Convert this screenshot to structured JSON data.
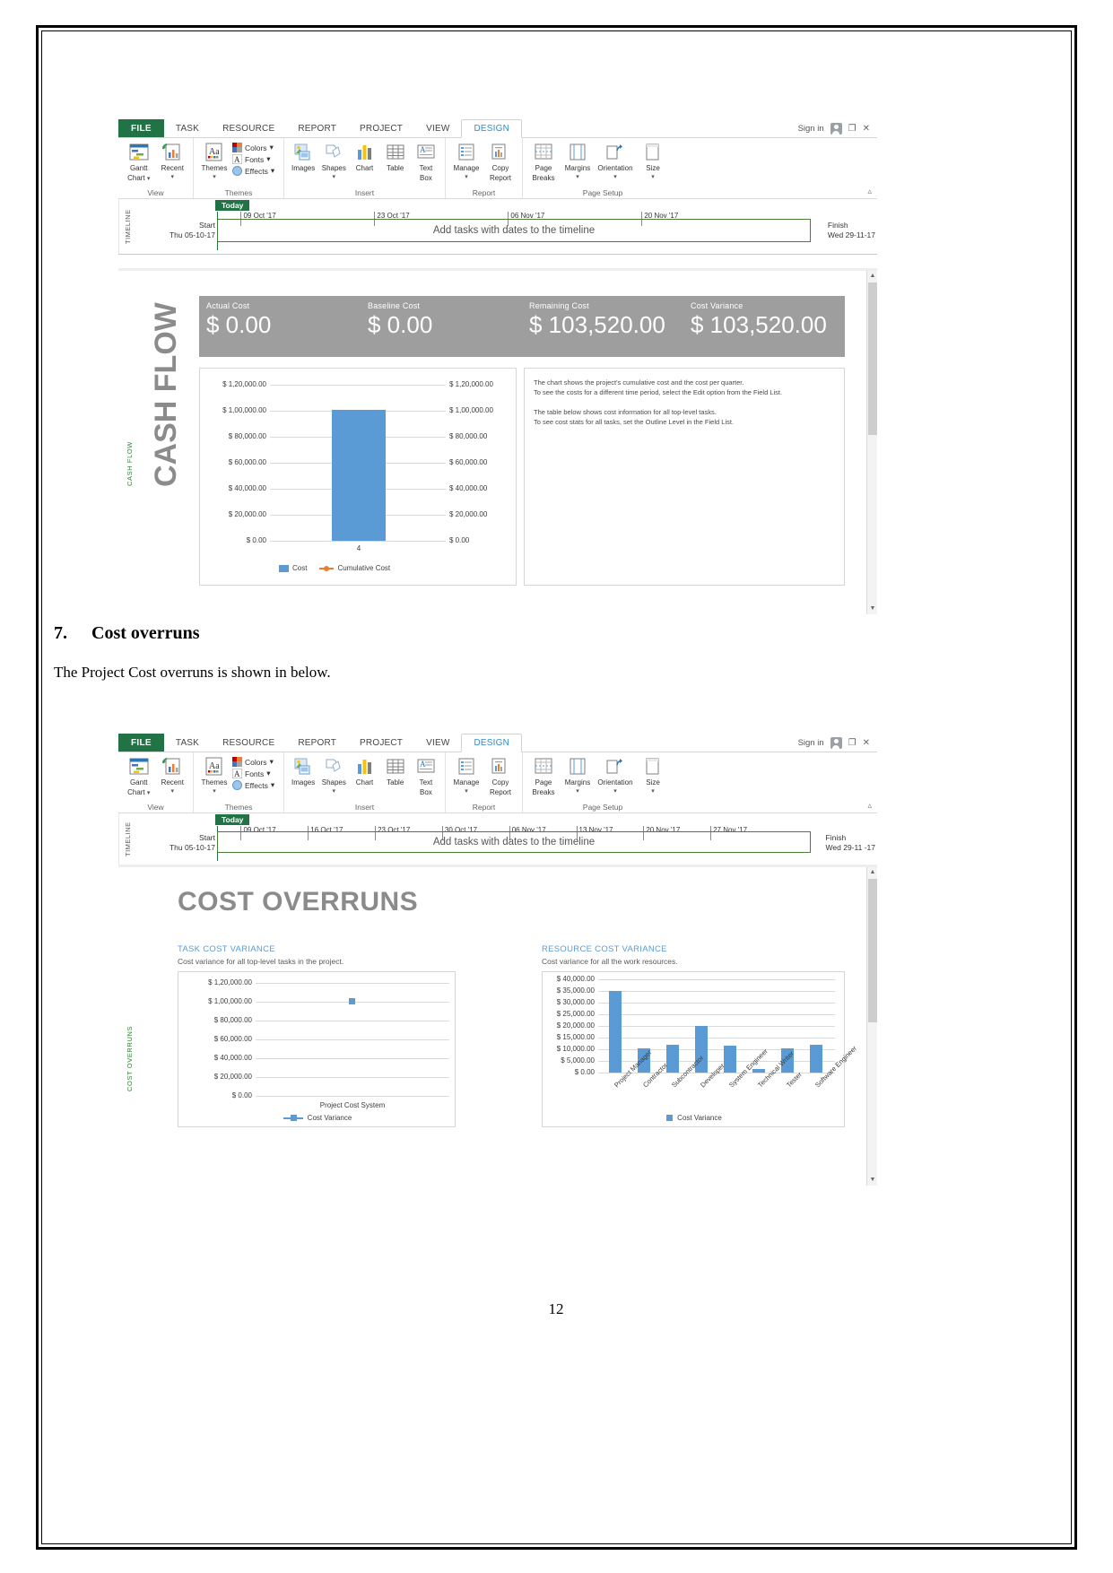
{
  "document": {
    "page_number": "12",
    "heading_number": "7.",
    "heading_text": "Cost overruns",
    "paragraph": "The Project Cost overruns is shown in below."
  },
  "ribbon": {
    "file_tab": "FILE",
    "tabs": [
      "TASK",
      "RESOURCE",
      "REPORT",
      "PROJECT",
      "VIEW"
    ],
    "active_tab": "DESIGN",
    "sign_in": "Sign in",
    "restore_icon": "restore-window-icon",
    "close_icon": "close-icon",
    "collapse_icon": "collapse-ribbon-icon",
    "groups": [
      {
        "label": "View",
        "buttons": [
          {
            "label_1": "Gantt",
            "label_2": "Chart",
            "caret": true,
            "icon": "gantt-chart-icon"
          },
          {
            "label_1": "Recent",
            "label_2": "",
            "caret": true,
            "icon": "recent-reports-icon"
          }
        ]
      },
      {
        "label": "Themes",
        "buttons": [
          {
            "label_1": "Themes",
            "label_2": "",
            "caret": true,
            "icon": "themes-icon"
          }
        ],
        "small_buttons": [
          {
            "label": "Colors",
            "icon": "colors-icon"
          },
          {
            "label": "Fonts",
            "icon": "fonts-icon"
          },
          {
            "label": "Effects",
            "icon": "effects-icon"
          }
        ]
      },
      {
        "label": "Insert",
        "buttons": [
          {
            "label_1": "Images",
            "label_2": "",
            "caret": false,
            "icon": "images-icon"
          },
          {
            "label_1": "Shapes",
            "label_2": "",
            "caret": true,
            "icon": "shapes-icon"
          },
          {
            "label_1": "Chart",
            "label_2": "",
            "caret": false,
            "icon": "chart-icon"
          },
          {
            "label_1": "Table",
            "label_2": "",
            "caret": false,
            "icon": "table-icon"
          },
          {
            "label_1": "Text",
            "label_2": "Box",
            "caret": false,
            "icon": "text-box-icon"
          }
        ]
      },
      {
        "label": "Report",
        "buttons": [
          {
            "label_1": "Manage",
            "label_2": "",
            "caret": true,
            "icon": "manage-icon"
          },
          {
            "label_1": "Copy",
            "label_2": "Report",
            "caret": false,
            "icon": "copy-report-icon"
          }
        ]
      },
      {
        "label": "Page Setup",
        "buttons": [
          {
            "label_1": "Page",
            "label_2": "Breaks",
            "caret": false,
            "icon": "page-breaks-icon"
          },
          {
            "label_1": "Margins",
            "label_2": "",
            "caret": true,
            "icon": "margins-icon"
          },
          {
            "label_1": "Orientation",
            "label_2": "",
            "caret": true,
            "icon": "orientation-icon"
          },
          {
            "label_1": "Size",
            "label_2": "",
            "caret": true,
            "icon": "size-icon"
          }
        ]
      }
    ]
  },
  "timeline_1": {
    "side_label": "TIMELINE",
    "today_badge": "Today",
    "start_label": "Start",
    "start_date": "Thu 05-10-17",
    "finish_label": "Finish",
    "finish_date": "Wed 29-11-17",
    "bar_text": "Add tasks with dates to the timeline",
    "ticks": [
      "09 Oct '17",
      "23 Oct '17",
      "06 Nov '17",
      "20 Nov '17"
    ]
  },
  "timeline_2": {
    "side_label": "TIMELINE",
    "today_badge": "Today",
    "start_label": "Start",
    "start_date": "Thu 05-10-17",
    "finish_label": "Finish",
    "finish_date": "Wed 29-11 -17",
    "bar_text": "Add tasks with dates to the timeline",
    "ticks": [
      "09 Oct '17",
      "16 Oct '17",
      "23 Oct '17",
      "30 Oct '17",
      "06 Nov '17",
      "13 Nov '17",
      "20 Nov '17",
      "27 Nov '17"
    ]
  },
  "cash_flow_report": {
    "side_label": "CASH FLOW",
    "title": "CASH FLOW",
    "kpis": [
      {
        "label": "Actual Cost",
        "value": "$ 0.00"
      },
      {
        "label": "Baseline Cost",
        "value": "$ 0.00"
      },
      {
        "label": "Remaining Cost",
        "value": "$ 103,520.00"
      },
      {
        "label": "Cost Variance",
        "value": "$ 103,520.00"
      }
    ],
    "description": "The chart shows the project's cumulative cost and the cost per quarter.\nTo see the costs for a different time period, select the Edit option from the Field List.\n\nThe table below shows cost information for all top-level tasks.\nTo see cost stats for all tasks, set the Outline Level in the Field List."
  },
  "cost_overruns_report": {
    "side_label": "COST OVERRUNS",
    "title": "COST OVERRUNS",
    "task_section": {
      "heading": "TASK COST VARIANCE",
      "description": "Cost variance for all top-level tasks in the project."
    },
    "resource_section": {
      "heading": "RESOURCE COST VARIANCE",
      "description": "Cost variance for all the work resources."
    }
  },
  "chart_data": [
    {
      "type": "bar",
      "title": "Cash Flow",
      "categories": [
        "4"
      ],
      "values": [
        103520
      ],
      "series": [
        {
          "name": "Cost",
          "values": [
            103520
          ],
          "color": "#5b9bd5"
        },
        {
          "name": "Cumulative Cost",
          "values": [
            103520
          ],
          "color": "#ed7d31"
        }
      ],
      "legend": [
        "Cost",
        "Cumulative Cost"
      ],
      "legend_position": "bottom",
      "ylabel": "",
      "xlabel": "",
      "ylim": [
        0,
        120000
      ],
      "yticks": [
        "$ 0.00",
        "$ 20,000.00",
        "$ 40,000.00",
        "$ 60,000.00",
        "$ 80,000.00",
        "$ 1,00,000.00",
        "$ 1,20,000.00"
      ],
      "ytick_values": [
        0,
        20000,
        40000,
        60000,
        80000,
        100000,
        120000
      ],
      "secondary_yticks": [
        "$ 0.00",
        "$ 20,000.00",
        "$ 40,000.00",
        "$ 60,000.00",
        "$ 80,000.00",
        "$ 1,00,000.00",
        "$ 1,20,000.00"
      ],
      "grid": true
    },
    {
      "type": "line",
      "title": "TASK COST VARIANCE",
      "categories": [
        "Project Cost System"
      ],
      "values": [
        103520
      ],
      "series": [
        {
          "name": "Cost Variance",
          "values": [
            103520
          ],
          "color": "#5b9bd5"
        }
      ],
      "legend": [
        "Cost Variance"
      ],
      "legend_position": "bottom",
      "ylim": [
        0,
        120000
      ],
      "yticks": [
        "$ 0.00",
        "$ 20,000.00",
        "$ 40,000.00",
        "$ 60,000.00",
        "$ 80,000.00",
        "$ 1,00,000.00",
        "$ 1,20,000.00"
      ],
      "ytick_values": [
        0,
        20000,
        40000,
        60000,
        80000,
        100000,
        120000
      ],
      "grid": true
    },
    {
      "type": "bar",
      "title": "RESOURCE COST VARIANCE",
      "categories": [
        "Project Manager",
        "Contractor",
        "Subcontractor",
        "Developer",
        "System Engineer",
        "Technical Writer",
        "Tester",
        "Software Engineer"
      ],
      "values": [
        35000,
        10500,
        12000,
        20000,
        11500,
        1500,
        10500,
        12000
      ],
      "series": [
        {
          "name": "Cost Variance",
          "values": [
            35000,
            10500,
            12000,
            20000,
            11500,
            1500,
            10500,
            12000
          ],
          "color": "#5b9bd5"
        }
      ],
      "legend": [
        "Cost Variance"
      ],
      "legend_position": "bottom",
      "ylim": [
        0,
        40000
      ],
      "yticks": [
        "$ 0.00",
        "$ 5,000.00",
        "$ 10,000.00",
        "$ 15,000.00",
        "$ 20,000.00",
        "$ 25,000.00",
        "$ 30,000.00",
        "$ 35,000.00",
        "$ 40,000.00"
      ],
      "ytick_values": [
        0,
        5000,
        10000,
        15000,
        20000,
        25000,
        30000,
        35000,
        40000
      ],
      "grid": true
    }
  ]
}
